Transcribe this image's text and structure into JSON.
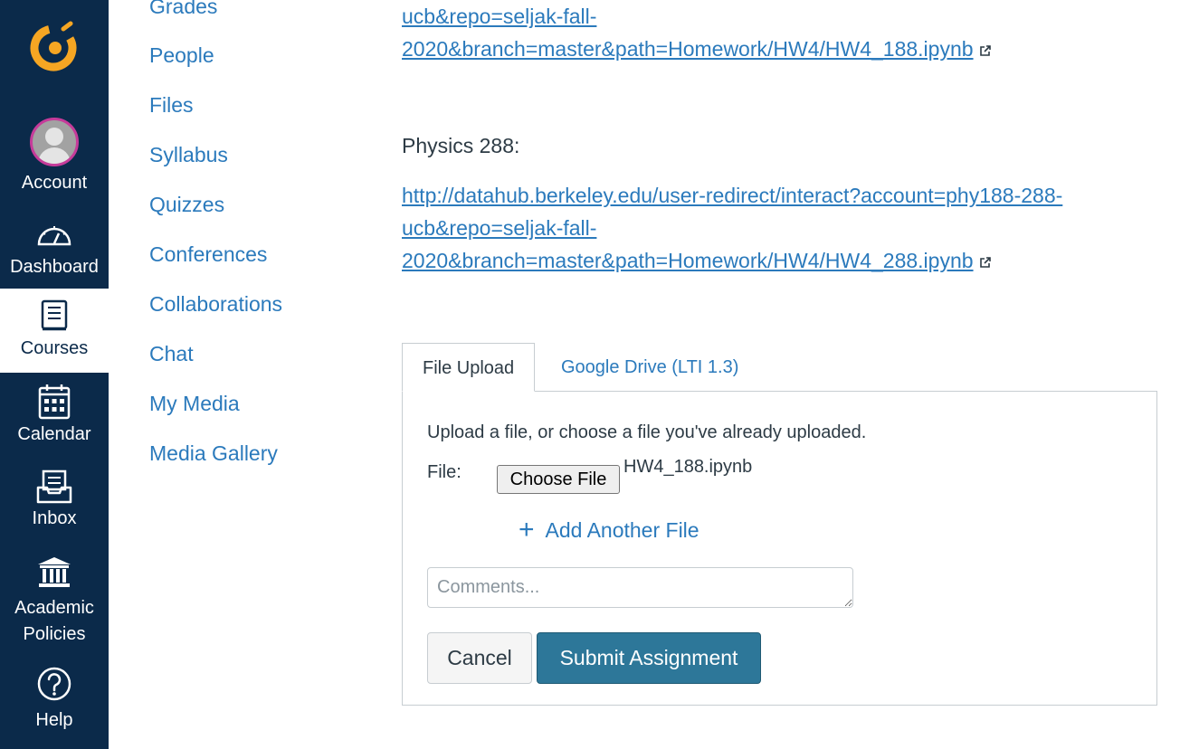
{
  "global_nav": {
    "account": "Account",
    "dashboard": "Dashboard",
    "courses": "Courses",
    "calendar": "Calendar",
    "inbox": "Inbox",
    "academic_policies_line1": "Academic",
    "academic_policies_line2": "Policies",
    "help": "Help"
  },
  "course_nav": {
    "items": [
      {
        "label": "Grades"
      },
      {
        "label": "People"
      },
      {
        "label": "Files"
      },
      {
        "label": "Syllabus"
      },
      {
        "label": "Quizzes"
      },
      {
        "label": "Conferences"
      },
      {
        "label": "Collaborations"
      },
      {
        "label": "Chat"
      },
      {
        "label": "My Media"
      },
      {
        "label": "Media Gallery"
      }
    ]
  },
  "content": {
    "link188_line1": "ucb&repo=seljak-fall-",
    "link188_line2": "2020&branch=master&path=Homework/HW4/HW4_188.ipynb",
    "physics288_label": "Physics 288:",
    "link288_line0": "http://datahub.berkeley.edu/user-redirect/interact?account=phy188-288-",
    "link288_line1": "ucb&repo=seljak-fall-",
    "link288_line2": "2020&branch=master&path=Homework/HW4/HW4_288.ipynb"
  },
  "submission": {
    "tabs": [
      {
        "label": "File Upload"
      },
      {
        "label": "Google Drive (LTI 1.3)"
      }
    ],
    "intro": "Upload a file, or choose a file you've already uploaded.",
    "file_label": "File:",
    "choose_file_label": "Choose File",
    "selected_file": "HW4_188.ipynb",
    "add_another_file": "Add Another File",
    "comments_placeholder": "Comments...",
    "cancel_label": "Cancel",
    "submit_label": "Submit Assignment"
  },
  "colors": {
    "nav_bg": "#0b2a4a",
    "link": "#2b7abc",
    "submit_bg": "#2d7799",
    "logo": "#f6a623"
  }
}
